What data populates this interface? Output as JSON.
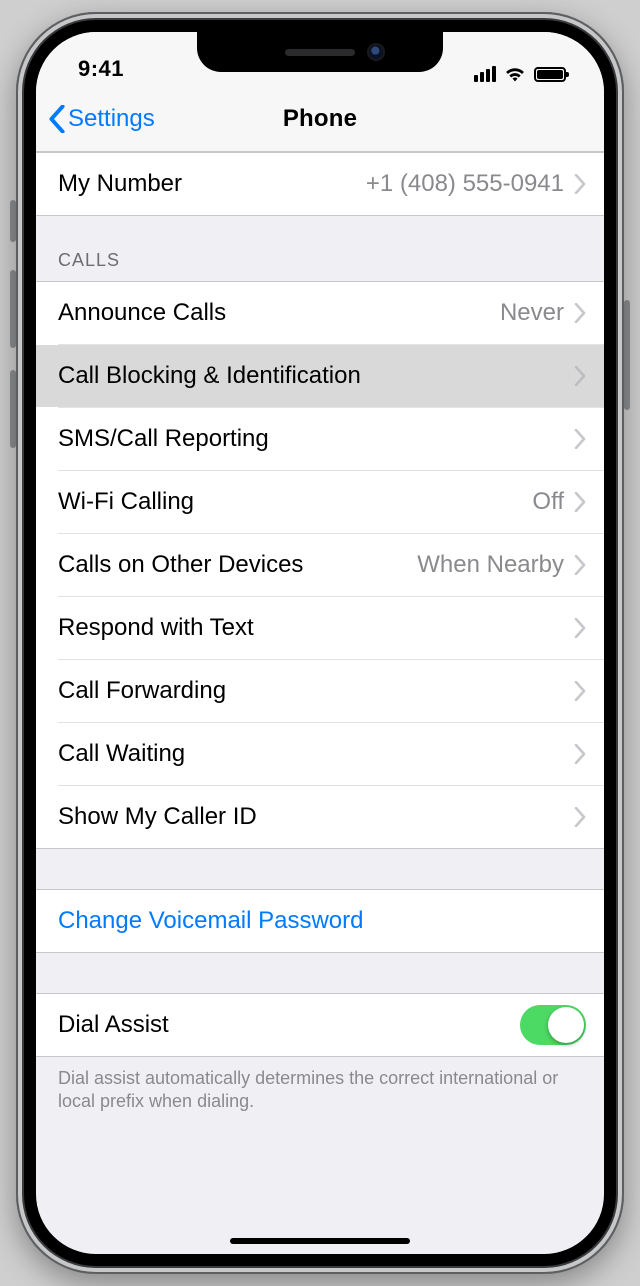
{
  "statusbar": {
    "time": "9:41"
  },
  "navbar": {
    "back_label": "Settings",
    "title": "Phone"
  },
  "my_number": {
    "label": "My Number",
    "value": "+1 (408) 555-0941"
  },
  "calls_header": "CALLS",
  "calls": [
    {
      "label": "Announce Calls",
      "value": "Never",
      "highlight": false
    },
    {
      "label": "Call Blocking & Identification",
      "value": "",
      "highlight": true
    },
    {
      "label": "SMS/Call Reporting",
      "value": "",
      "highlight": false
    },
    {
      "label": "Wi-Fi Calling",
      "value": "Off",
      "highlight": false
    },
    {
      "label": "Calls on Other Devices",
      "value": "When Nearby",
      "highlight": false
    },
    {
      "label": "Respond with Text",
      "value": "",
      "highlight": false
    },
    {
      "label": "Call Forwarding",
      "value": "",
      "highlight": false
    },
    {
      "label": "Call Waiting",
      "value": "",
      "highlight": false
    },
    {
      "label": "Show My Caller ID",
      "value": "",
      "highlight": false
    }
  ],
  "voicemail": {
    "label": "Change Voicemail Password"
  },
  "dial_assist": {
    "label": "Dial Assist",
    "on": true,
    "footer": "Dial assist automatically determines the correct international or local prefix when dialing."
  }
}
